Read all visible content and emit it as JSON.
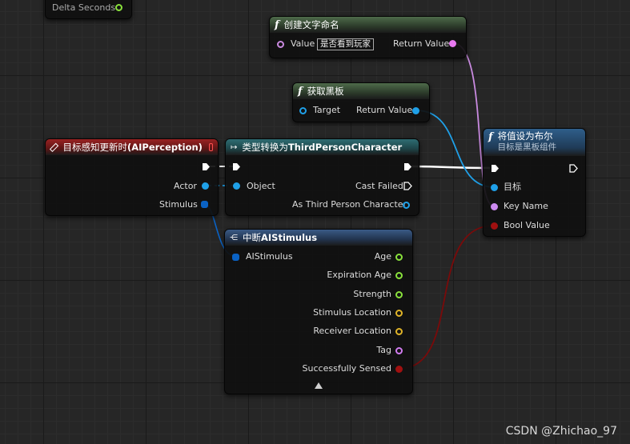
{
  "tick_node": {
    "pin_label": "Delta Seconds"
  },
  "create_text_node": {
    "title": "创建文字命名",
    "value_label": "Value",
    "value_input": "是否看到玩家",
    "return_label": "Return Value"
  },
  "get_blackboard_node": {
    "title": "获取黑板",
    "target_label": "Target",
    "return_label": "Return Value"
  },
  "perception_event_node": {
    "title_prefix": "目标感知更新时 ",
    "title_suffix": "(AIPerception)",
    "actor_label": "Actor",
    "stimulus_label": "Stimulus"
  },
  "cast_node": {
    "title_prefix": "类型转换为 ",
    "title_suffix": "ThirdPersonCharacter",
    "object_label": "Object",
    "cast_failed_label": "Cast Failed",
    "as_label": "As Third Person Character"
  },
  "set_bool_node": {
    "title": "将值设为布尔",
    "subtitle": "目标是黑板组件",
    "target_label": "目标",
    "key_name_label": "Key Name",
    "bool_value_label": "Bool Value"
  },
  "break_stimulus_node": {
    "title_prefix": "中断",
    "title_suffix": "AIStimulus",
    "input_label": "AIStimulus",
    "outputs": [
      {
        "label": "Age",
        "color": "#8ae23c"
      },
      {
        "label": "Expiration Age",
        "color": "#8ae23c"
      },
      {
        "label": "Strength",
        "color": "#8ae23c"
      },
      {
        "label": "Stimulus Location",
        "color": "#e0b428"
      },
      {
        "label": "Receiver Location",
        "color": "#e0b428"
      },
      {
        "label": "Tag",
        "color": "#d27cf0"
      },
      {
        "label": "Successfully Sensed",
        "color": "#9a0c0c"
      }
    ]
  },
  "colors": {
    "object_pin": "#1fa0e8",
    "struct_pin": "#0a62c4",
    "text_pin": "#e879f0",
    "name_pin": "#cc8af0",
    "bool_pin": "#a01010",
    "float_pin": "#8ae23c",
    "vector_pin": "#e0b428"
  },
  "watermark": "CSDN @Zhichao_97"
}
